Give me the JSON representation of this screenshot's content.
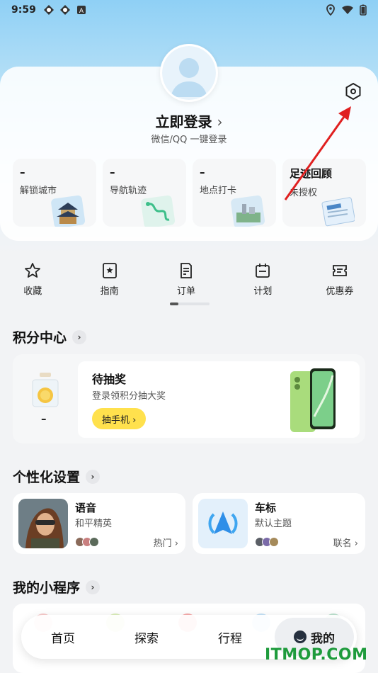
{
  "status_bar": {
    "time": "9:59"
  },
  "profile": {
    "login_title": "立即登录",
    "login_chevron": "›",
    "login_subtitle": "微信/QQ 一键登录"
  },
  "stats": [
    {
      "value": "–",
      "label": "解锁城市",
      "icon": "temple-icon"
    },
    {
      "value": "–",
      "label": "导航轨迹",
      "icon": "route-map-icon"
    },
    {
      "value": "–",
      "label": "地点打卡",
      "icon": "landscape-photo-icon"
    },
    {
      "value": "足迹回顾",
      "label": "未授权",
      "icon": "newspaper-icon"
    }
  ],
  "quick_actions": [
    {
      "label": "收藏",
      "icon": "star-icon"
    },
    {
      "label": "指南",
      "icon": "guide-book-icon"
    },
    {
      "label": "订单",
      "icon": "order-icon"
    },
    {
      "label": "计划",
      "icon": "calendar-icon"
    },
    {
      "label": "优惠券",
      "icon": "coupon-icon"
    }
  ],
  "points_center": {
    "title": "积分中心",
    "chevron": "›",
    "balance": "–",
    "draw_title": "待抽奖",
    "draw_subtitle": "登录领积分抽大奖",
    "draw_button": "抽手机 ›"
  },
  "personalization": {
    "title": "个性化设置",
    "chevron": "›",
    "voice": {
      "title": "语音",
      "subtitle": "和平精英",
      "tag": "热门 ›"
    },
    "car_icon": {
      "title": "车标",
      "subtitle": "默认主题",
      "tag": "联名 ›"
    }
  },
  "mini_programs": {
    "title": "我的小程序",
    "chevron": "›"
  },
  "bottom_nav": {
    "items": [
      "首页",
      "探索",
      "行程"
    ],
    "active": "我的"
  },
  "watermark": "ITMOP.COM",
  "colors": {
    "accent_yellow": "#ffe14d",
    "annotation_arrow": "#e02020",
    "watermark_green": "#1e9b3c"
  }
}
